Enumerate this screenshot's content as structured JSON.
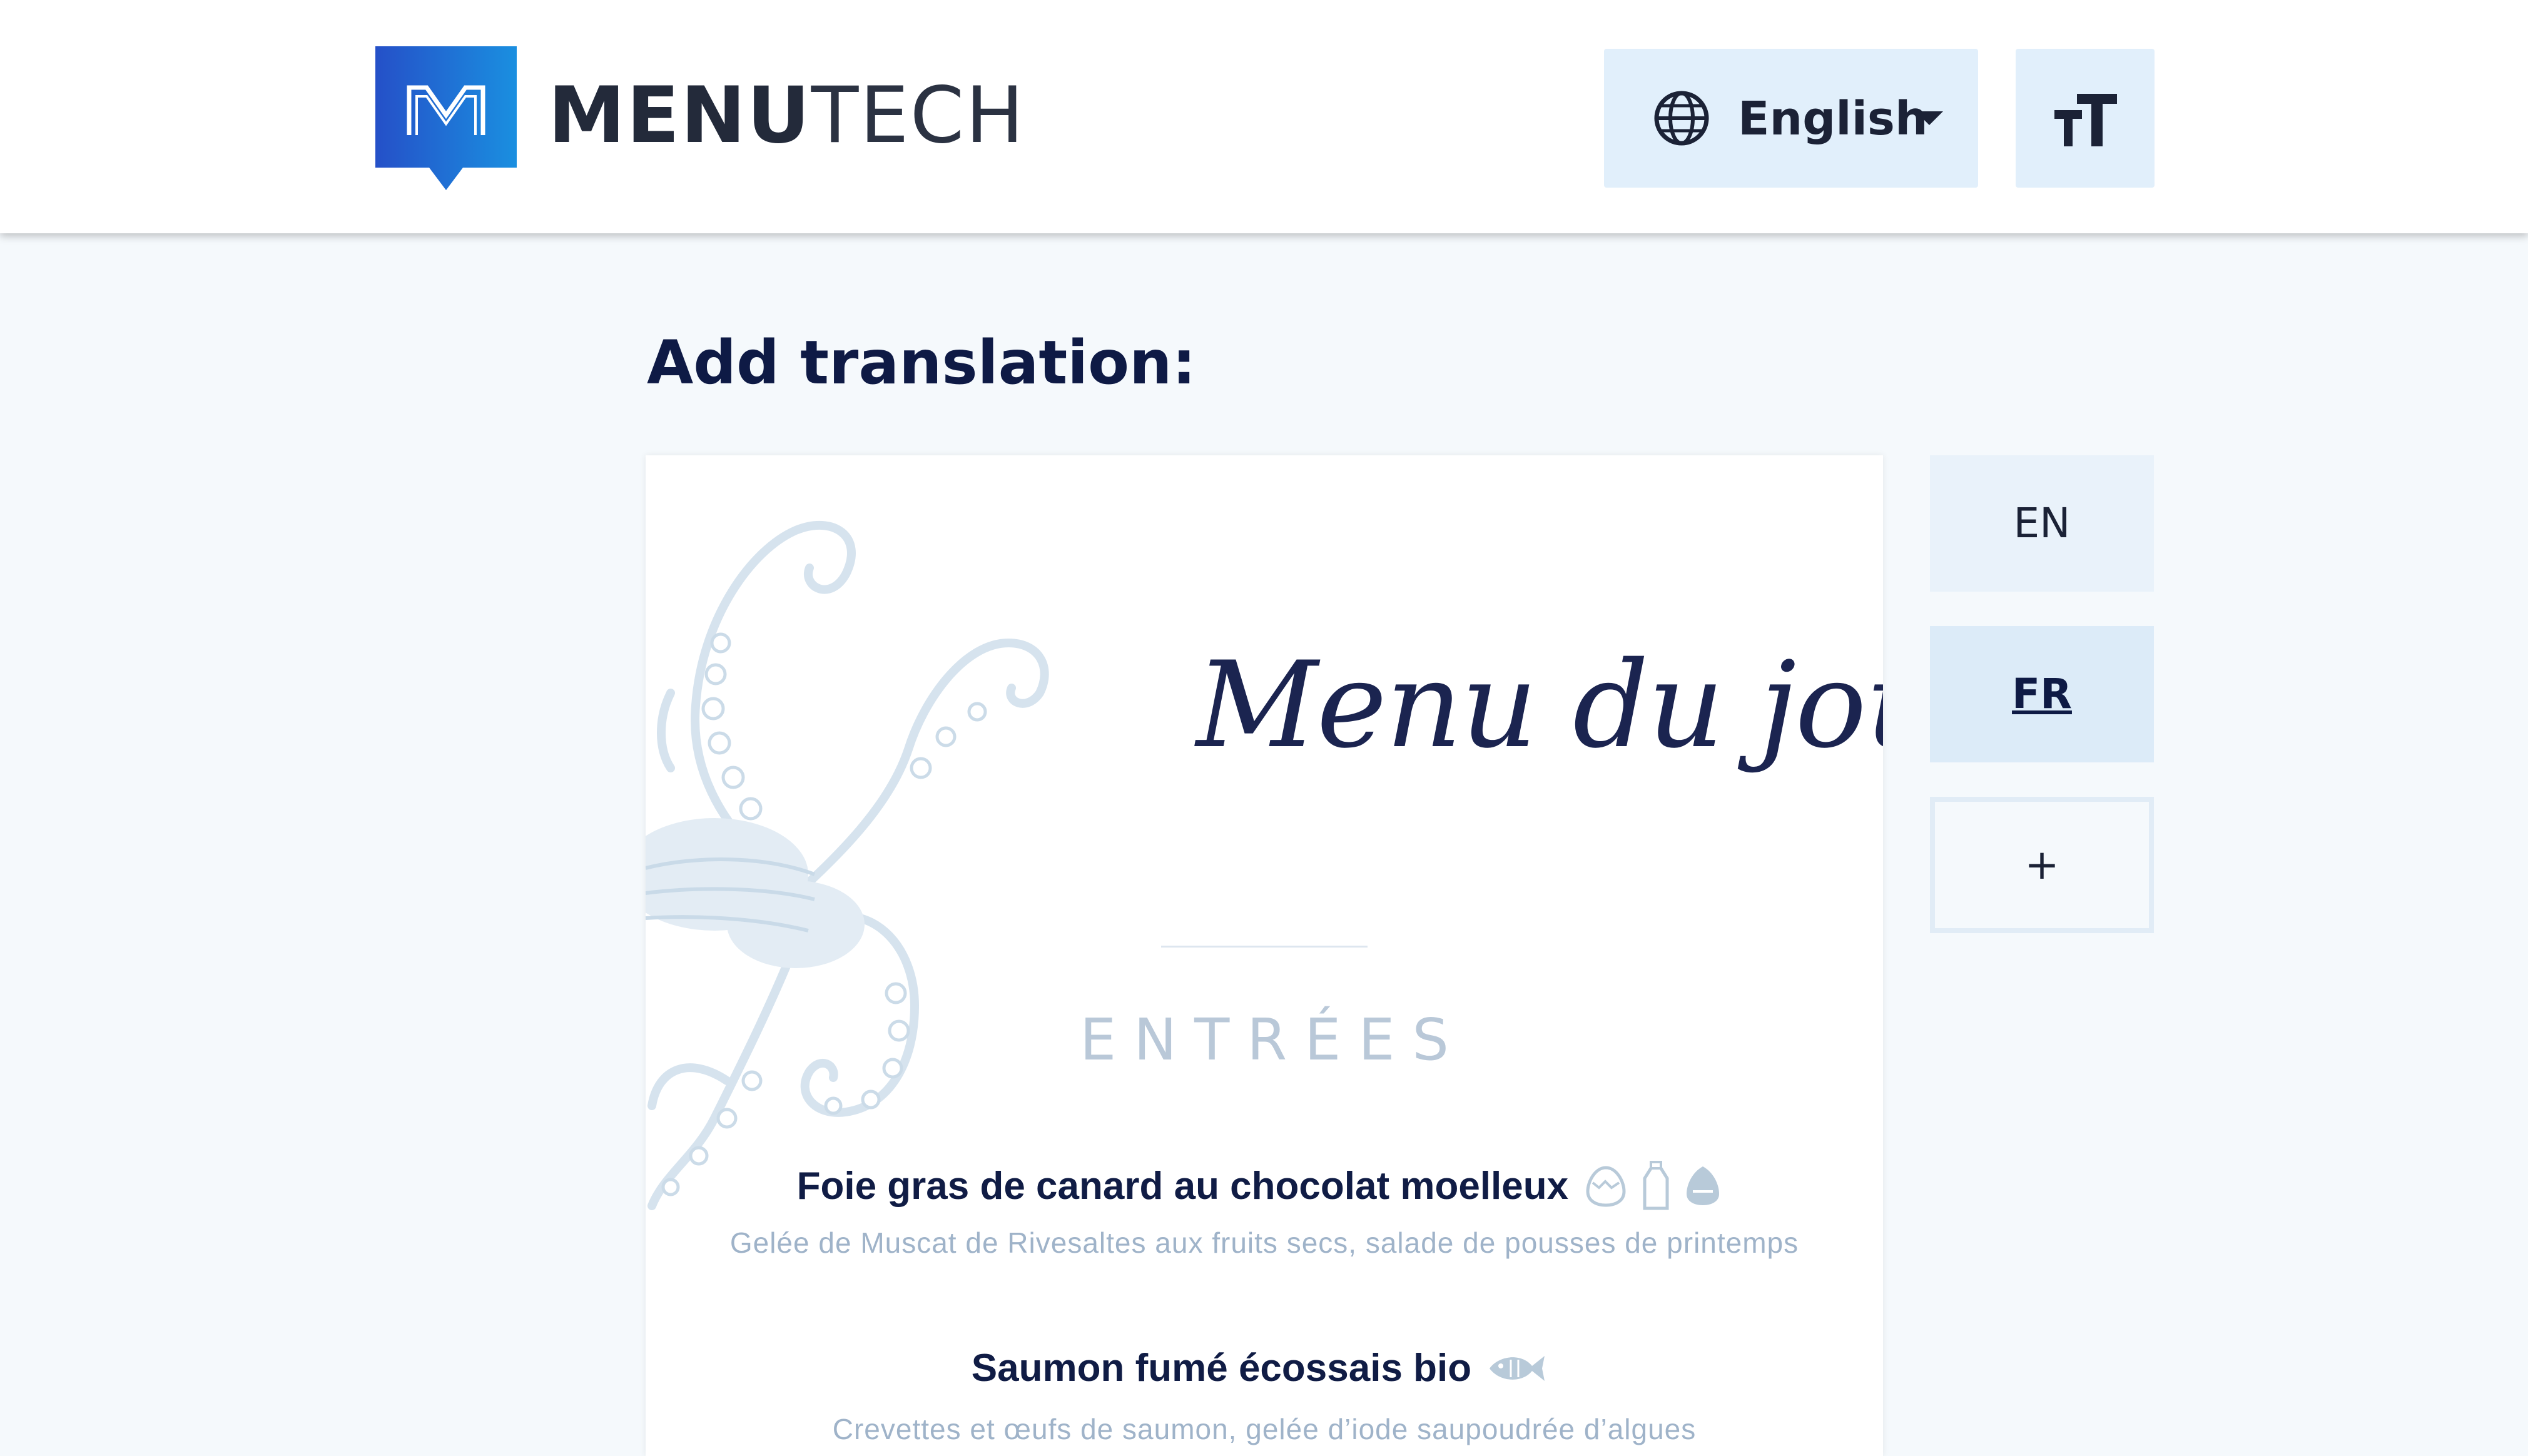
{
  "brand": {
    "name_bold": "MENU",
    "name_light": "TECH",
    "primary_color": "#1a8fe0",
    "secondary_color": "#2550c8"
  },
  "header": {
    "language_select": {
      "label": "English",
      "icon": "globe-icon",
      "chevron": "caret-down-icon"
    },
    "text_size_icon": "text-size-icon"
  },
  "page": {
    "title": "Add translation:"
  },
  "menu_card": {
    "title": "Menu du jour",
    "section_title": "ENTRÉES",
    "dishes": [
      {
        "name": "Foie gras de canard au chocolat moelleux",
        "description": "Gelée de Muscat de Rivesaltes aux fruits secs, salade de pousses de printemps",
        "allergen_icons": [
          "egg-icon",
          "milk-bottle-icon",
          "nut-icon"
        ]
      },
      {
        "name": "Saumon fumé écossais bio",
        "description": "Crevettes et œufs de saumon, gelée d’iode saupoudrée d’algues",
        "allergen_icons": [
          "fish-icon"
        ]
      }
    ]
  },
  "language_tabs": {
    "items": [
      {
        "label": "EN",
        "active": false
      },
      {
        "label": "FR",
        "active": true
      },
      {
        "label": "+",
        "active": false
      }
    ]
  }
}
